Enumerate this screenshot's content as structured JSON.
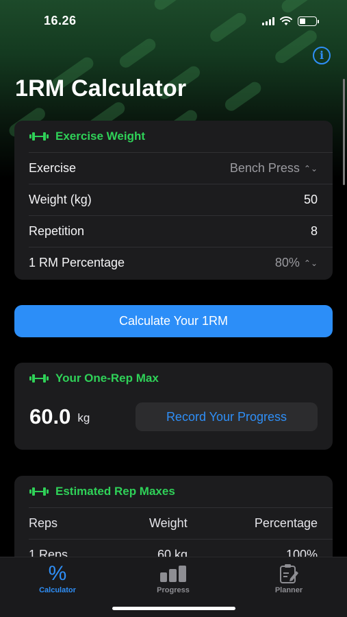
{
  "status": {
    "time": "16.26"
  },
  "header": {
    "title": "1RM Calculator",
    "info_icon": "info-circle-icon"
  },
  "exercise_card": {
    "title": "Exercise Weight",
    "rows": [
      {
        "label": "Exercise",
        "value": "Bench Press"
      },
      {
        "label": "Weight (kg)",
        "value": "50"
      },
      {
        "label": "Repetition",
        "value": "8"
      },
      {
        "label": "1 RM Percentage",
        "value": "80%"
      }
    ]
  },
  "calculate_button": "Calculate Your 1RM",
  "one_rep_max": {
    "title": "Your One-Rep Max",
    "value": "60.0",
    "unit": "kg",
    "record_button": "Record Your Progress"
  },
  "estimated": {
    "title": "Estimated Rep Maxes",
    "columns": [
      "Reps",
      "Weight",
      "Percentage"
    ],
    "rows": [
      {
        "reps": "1 Reps",
        "weight": "60 kg",
        "percentage": "100%"
      }
    ]
  },
  "tabs": [
    {
      "label": "Calculator",
      "icon": "percent-icon",
      "active": true
    },
    {
      "label": "Progress",
      "icon": "bar-chart-icon",
      "active": false
    },
    {
      "label": "Planner",
      "icon": "clipboard-edit-icon",
      "active": false
    }
  ],
  "colors": {
    "accent_green": "#2fd158",
    "accent_blue": "#2c8ef8",
    "card_bg": "#1c1c1e",
    "background": "#000000"
  }
}
